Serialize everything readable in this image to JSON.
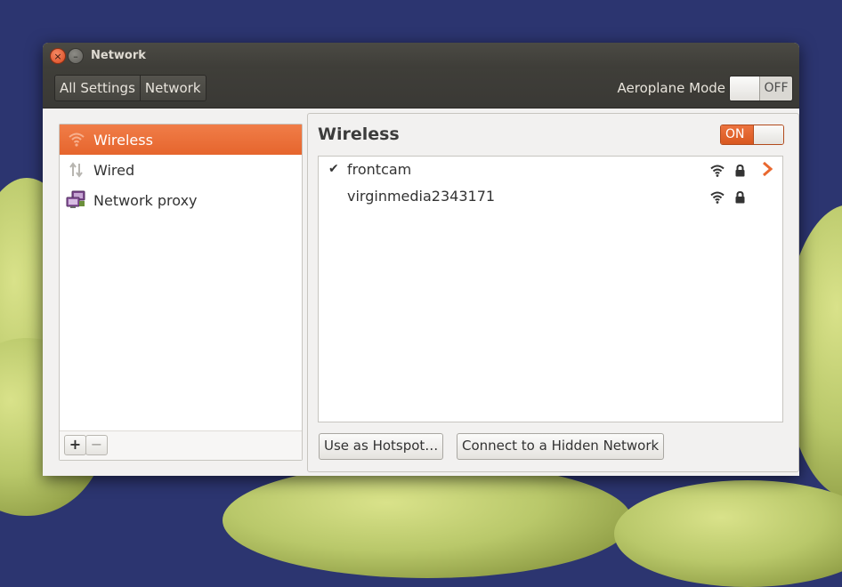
{
  "window": {
    "title": "Network"
  },
  "toolbar": {
    "breadcrumbs": [
      "All Settings",
      "Network"
    ],
    "aeroplane_label": "Aeroplane Mode",
    "aeroplane_state": "OFF"
  },
  "sidebar": {
    "items": [
      {
        "label": "Wireless",
        "icon": "wifi-icon",
        "active": true
      },
      {
        "label": "Wired",
        "icon": "wired-arrows-icon",
        "active": false
      },
      {
        "label": "Network proxy",
        "icon": "network-proxy-icon",
        "active": false
      }
    ],
    "add_label": "+",
    "remove_label": "−"
  },
  "main": {
    "title": "Wireless",
    "wireless_state": "ON",
    "networks": [
      {
        "ssid": "frontcam",
        "connected": true,
        "check": "✔",
        "secured": true
      },
      {
        "ssid": "virginmedia2343171",
        "connected": false,
        "check": "",
        "secured": true
      }
    ],
    "hotspot_button": "Use as Hotspot…",
    "hidden_network_button": "Connect to a Hidden Network"
  },
  "colors": {
    "accent": "#e9682f",
    "titlebar": "#3e3d38",
    "window_bg": "#f2f1f0",
    "desktop": "#2c3570"
  }
}
